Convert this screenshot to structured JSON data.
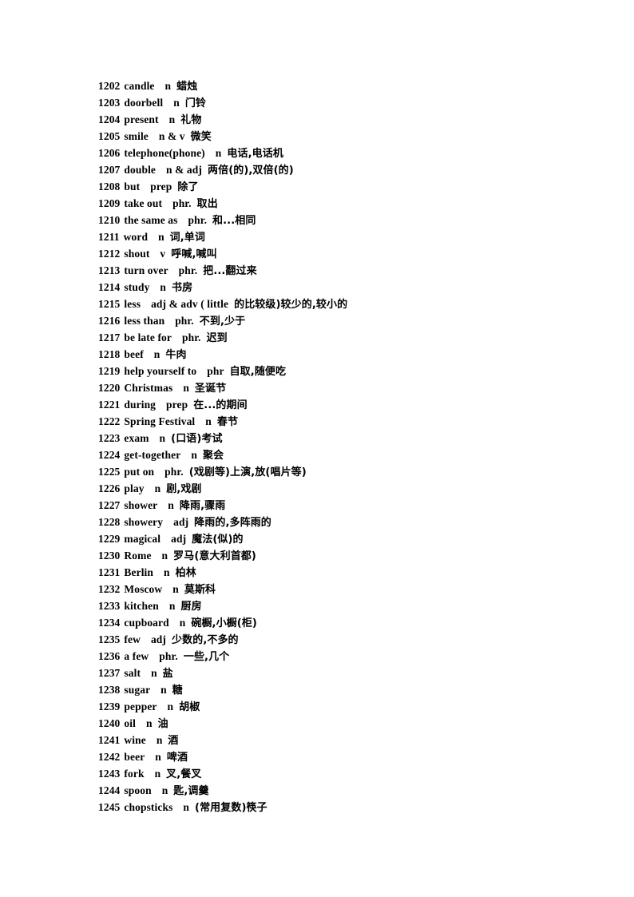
{
  "document": {
    "type": "vocabulary-list",
    "background_color": "#ffffff",
    "text_color": "#000000",
    "entries": [
      {
        "num": "1202",
        "term": "candle",
        "pos": "n",
        "gloss": "蜡烛"
      },
      {
        "num": "1203",
        "term": "doorbell",
        "pos": "n",
        "gloss": "门铃"
      },
      {
        "num": "1204",
        "term": "present",
        "pos": "n",
        "gloss": "礼物"
      },
      {
        "num": "1205",
        "term": "smile",
        "pos": "n & v",
        "gloss": "微笑"
      },
      {
        "num": "1206",
        "term": "telephone(phone)",
        "pos": "n",
        "gloss": "电话,电话机"
      },
      {
        "num": "1207",
        "term": "double",
        "pos": "n & adj",
        "gloss": "两倍(的),双倍(的)"
      },
      {
        "num": "1208",
        "term": "but",
        "pos": "prep",
        "gloss": "除了"
      },
      {
        "num": "1209",
        "term": "take out",
        "pos": "phr.",
        "gloss": "取出"
      },
      {
        "num": "1210",
        "term": "the same as",
        "pos": "phr.",
        "gloss": "和...相同"
      },
      {
        "num": "1211",
        "term": "word",
        "pos": "n",
        "gloss": "词,单词"
      },
      {
        "num": "1212",
        "term": "shout",
        "pos": "v",
        "gloss": "呼喊,喊叫"
      },
      {
        "num": "1213",
        "term": "turn over",
        "pos": "phr.",
        "gloss": "把...翻过来"
      },
      {
        "num": "1214",
        "term": "study",
        "pos": "n",
        "gloss": "书房"
      },
      {
        "num": "1215",
        "term": "less",
        "pos": "adj & adv ( little",
        "gloss": "的比较级)较少的,较小的"
      },
      {
        "num": "1216",
        "term": "less than",
        "pos": "phr.",
        "gloss": "不到,少于"
      },
      {
        "num": "1217",
        "term": "be late for",
        "pos": "phr.",
        "gloss": "迟到"
      },
      {
        "num": "1218",
        "term": "beef",
        "pos": "n",
        "gloss": "牛肉"
      },
      {
        "num": "1219",
        "term": "help yourself    to",
        "pos": "phr",
        "gloss": "自取,随便吃"
      },
      {
        "num": "1220",
        "term": "Christmas",
        "pos": "n",
        "gloss": "圣诞节"
      },
      {
        "num": "1221",
        "term": "during",
        "pos": "prep",
        "gloss": "在...的期间"
      },
      {
        "num": "1222",
        "term": "Spring Festival",
        "pos": "n",
        "gloss": "春节"
      },
      {
        "num": "1223",
        "term": "exam",
        "pos": "n",
        "gloss": "(口语)考试"
      },
      {
        "num": "1224",
        "term": "get-together",
        "pos": "n",
        "gloss": "聚会"
      },
      {
        "num": "1225",
        "term": "put on",
        "pos": "phr.",
        "gloss": "(戏剧等)上演,放(唱片等)"
      },
      {
        "num": "1226",
        "term": "play",
        "pos": "n",
        "gloss": "剧,戏剧"
      },
      {
        "num": "1227",
        "term": "shower",
        "pos": "n",
        "gloss": "降雨,骤雨"
      },
      {
        "num": "1228",
        "term": "showery",
        "pos": "adj",
        "gloss": "降雨的,多阵雨的"
      },
      {
        "num": "1229",
        "term": "magical",
        "pos": "adj",
        "gloss": "魔法(似)的"
      },
      {
        "num": "1230",
        "term": "Rome",
        "pos": "n",
        "gloss": "罗马(意大利首都)"
      },
      {
        "num": "1231",
        "term": "Berlin",
        "pos": "n",
        "gloss": "柏林"
      },
      {
        "num": "1232",
        "term": "Moscow",
        "pos": "n",
        "gloss": "莫斯科"
      },
      {
        "num": "1233",
        "term": "kitchen",
        "pos": "n",
        "gloss": "厨房"
      },
      {
        "num": "1234",
        "term": "cupboard",
        "pos": "n",
        "gloss": "碗橱,小橱(柜)"
      },
      {
        "num": "1235",
        "term": "few",
        "pos": "adj",
        "gloss": "少数的,不多的"
      },
      {
        "num": "1236",
        "term": "a few",
        "pos": "phr.",
        "gloss": "一些,几个"
      },
      {
        "num": "1237",
        "term": "salt",
        "pos": "n",
        "gloss": "盐"
      },
      {
        "num": "1238",
        "term": "sugar",
        "pos": "n",
        "gloss": "糖"
      },
      {
        "num": "1239",
        "term": "pepper",
        "pos": "n",
        "gloss": "胡椒"
      },
      {
        "num": "1240",
        "term": "oil",
        "pos": "n",
        "gloss": "油"
      },
      {
        "num": "1241",
        "term": "wine",
        "pos": "n",
        "gloss": "酒"
      },
      {
        "num": "1242",
        "term": "beer",
        "pos": "n",
        "gloss": "啤酒"
      },
      {
        "num": "1243",
        "term": "fork",
        "pos": "n",
        "gloss": "叉,餐叉"
      },
      {
        "num": "1244",
        "term": "spoon",
        "pos": "n",
        "gloss": "匙,调羹"
      },
      {
        "num": "1245",
        "term": "chopsticks",
        "pos": "n",
        "gloss": "(常用复数)筷子"
      }
    ]
  }
}
